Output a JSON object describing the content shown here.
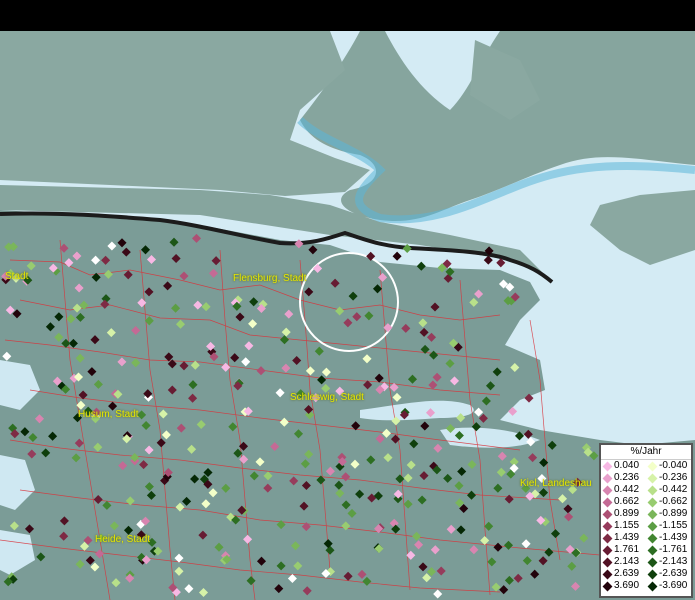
{
  "map": {
    "cities": [
      {
        "label": "Stadt"
      },
      {
        "label": "Flensburg, Stadt"
      },
      {
        "label": "Schleswig, Stadt"
      },
      {
        "label": "Husum, Stadt"
      },
      {
        "label": "Kiel, Landeshau"
      },
      {
        "label": "Heide, Stadt"
      }
    ]
  },
  "legend": {
    "title": "%/Jahr",
    "positive": [
      {
        "value": "0.040",
        "color": "#f7b8e4"
      },
      {
        "value": "0.236",
        "color": "#e9a0cc"
      },
      {
        "value": "0.442",
        "color": "#d885b0"
      },
      {
        "value": "0.662",
        "color": "#c46a95"
      },
      {
        "value": "0.899",
        "color": "#ad5074"
      },
      {
        "value": "1.155",
        "color": "#963c5c"
      },
      {
        "value": "1.439",
        "color": "#7e2a44"
      },
      {
        "value": "1.761",
        "color": "#671c33"
      },
      {
        "value": "2.143",
        "color": "#521224"
      },
      {
        "value": "2.639",
        "color": "#3a0917"
      },
      {
        "value": "3.690",
        "color": "#22030b"
      }
    ],
    "negative": [
      {
        "value": "-0.040",
        "color": "#f3ffc8"
      },
      {
        "value": "-0.236",
        "color": "#d6f2a8"
      },
      {
        "value": "-0.442",
        "color": "#b8e08a"
      },
      {
        "value": "-0.662",
        "color": "#98cc70"
      },
      {
        "value": "-0.899",
        "color": "#7ab65a"
      },
      {
        "value": "-1.155",
        "color": "#5c9e44"
      },
      {
        "value": "-1.439",
        "color": "#428631"
      },
      {
        "value": "-1.761",
        "color": "#2d6e22"
      },
      {
        "value": "-2.143",
        "color": "#1c5617"
      },
      {
        "value": "-2.639",
        "color": "#0f3f0c"
      },
      {
        "value": "-3.690",
        "color": "#052805"
      }
    ]
  }
}
